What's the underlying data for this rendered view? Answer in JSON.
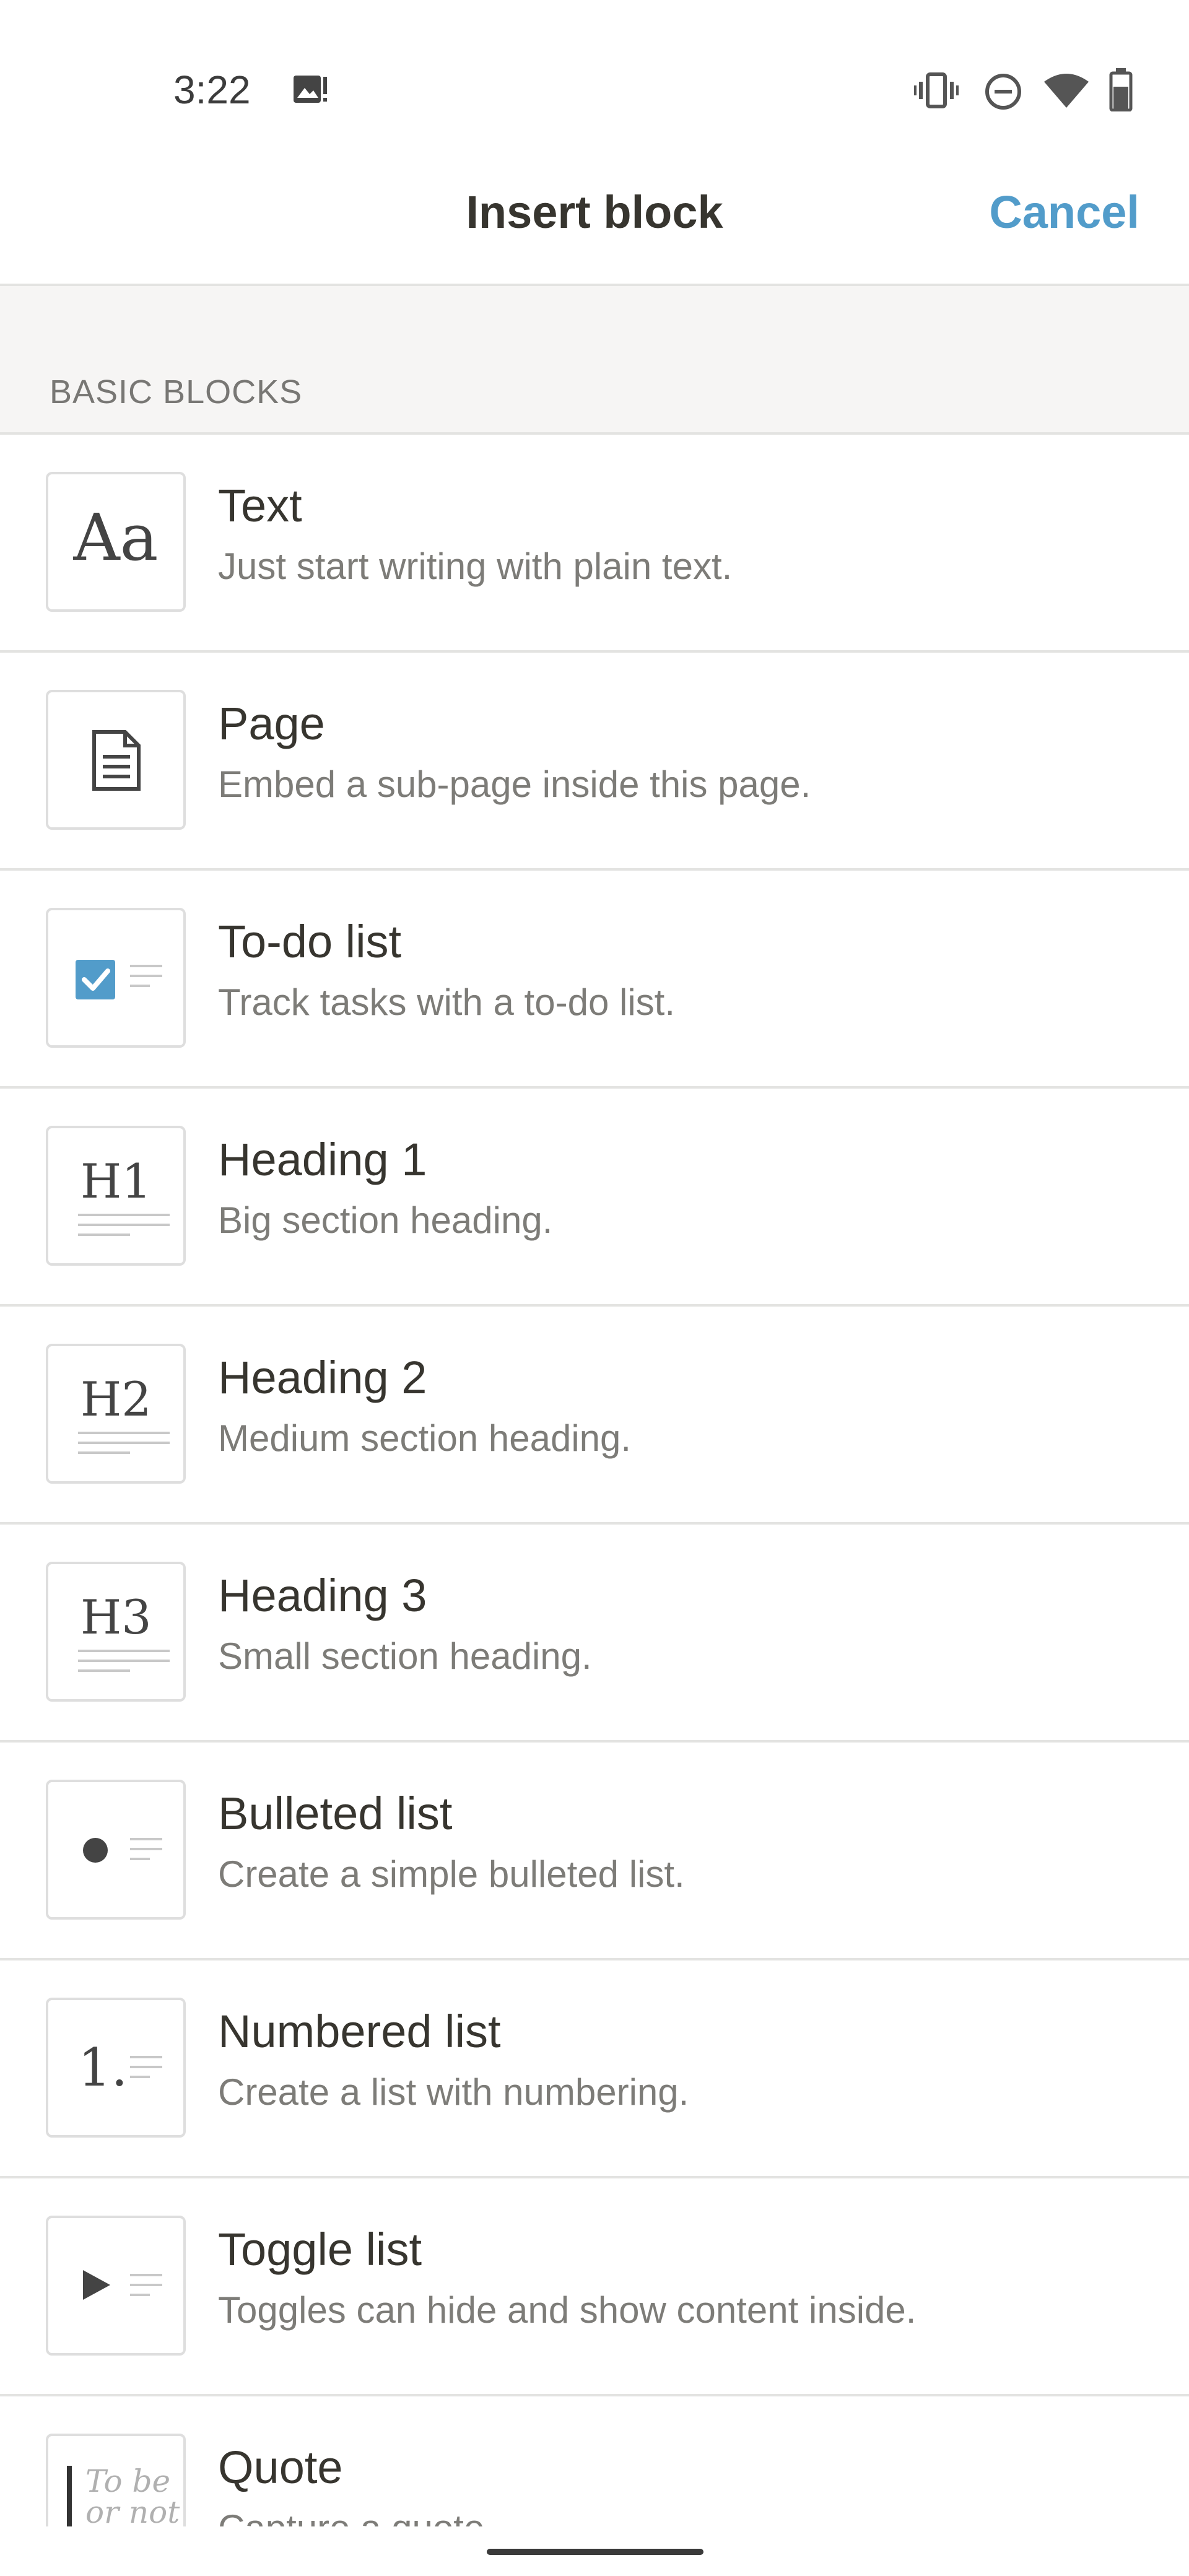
{
  "status_bar": {
    "time": "3:22",
    "icons": [
      "image-notification-icon",
      "vibrate-icon",
      "do-not-disturb-icon",
      "wifi-icon",
      "battery-icon"
    ]
  },
  "header": {
    "title": "Insert block",
    "cancel_label": "Cancel"
  },
  "section": {
    "label": "BASIC BLOCKS"
  },
  "blocks": [
    {
      "title": "Text",
      "description": "Just start writing with plain text.",
      "icon": "text-icon",
      "thumb_text": "Aa"
    },
    {
      "title": "Page",
      "description": "Embed a sub-page inside this page.",
      "icon": "page-icon"
    },
    {
      "title": "To-do list",
      "description": "Track tasks with a to-do list.",
      "icon": "checkbox-icon"
    },
    {
      "title": "Heading 1",
      "description": "Big section heading.",
      "icon": "heading-1-icon",
      "thumb_text": "H1"
    },
    {
      "title": "Heading 2",
      "description": "Medium section heading.",
      "icon": "heading-2-icon",
      "thumb_text": "H2"
    },
    {
      "title": "Heading 3",
      "description": "Small section heading.",
      "icon": "heading-3-icon",
      "thumb_text": "H3"
    },
    {
      "title": "Bulleted list",
      "description": "Create a simple bulleted list.",
      "icon": "bullet-icon"
    },
    {
      "title": "Numbered list",
      "description": "Create a list with numbering.",
      "icon": "number-icon",
      "thumb_text": "1."
    },
    {
      "title": "Toggle list",
      "description": "Toggles can hide and show content inside.",
      "icon": "toggle-icon"
    },
    {
      "title": "Quote",
      "description": "Capture a quote.",
      "icon": "quote-icon",
      "thumb_text": "To be or not"
    }
  ],
  "colors": {
    "accent": "#529cca",
    "text": "#37352f",
    "muted": "#787774",
    "divider": "#e3e3e1",
    "section_bg": "#f6f5f4"
  }
}
